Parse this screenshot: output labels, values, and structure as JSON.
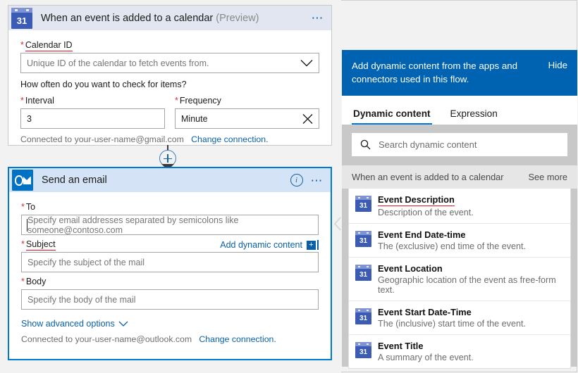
{
  "trigger_card": {
    "icon": "calendar-31-icon",
    "icon_text": "31",
    "title": "When an event is added to a calendar",
    "title_suffix": "(Preview)",
    "more_icon": "ellipsis-icon",
    "calendar_id_label": "Calendar ID",
    "calendar_id_placeholder": "Unique ID of the calendar to fetch events from.",
    "calendar_id_chevron": "chevron-down-icon",
    "check_question": "How often do you want to check for items?",
    "interval_label": "Interval",
    "interval_value": "3",
    "frequency_label": "Frequency",
    "frequency_value": "Minute",
    "frequency_clear_icon": "close-icon",
    "connected_text": "Connected to your-user-name@gmail.com",
    "change_connection": "Change connection.",
    "required_mark": "*"
  },
  "connector": {
    "add_step_icon": "plus-circle-icon",
    "arrow_icon": "arrow-down-icon"
  },
  "action_card": {
    "icon": "outlook-icon",
    "title": "Send an email",
    "info_icon": "info-icon",
    "more_icon": "ellipsis-icon",
    "to_label": "To",
    "to_placeholder": "Specify email addresses separated by semicolons like someone@contoso.com",
    "add_dynamic_content": "Add dynamic content",
    "add_dynamic_icon": "plus-square-icon",
    "subject_label": "Subject",
    "subject_placeholder": "Specify the subject of the mail",
    "body_label": "Body",
    "body_placeholder": "Specify the body of the mail",
    "show_advanced": "Show advanced options",
    "show_advanced_icon": "chevron-down-icon",
    "connected_text": "Connected to your-user-name@outlook.com",
    "change_connection": "Change connection.",
    "required_mark": "*"
  },
  "panel_handle_icon": "chevron-left-icon",
  "panel": {
    "header_text": "Add dynamic content from the apps and connectors used in this flow.",
    "hide_label": "Hide",
    "tabs": [
      {
        "label": "Dynamic content",
        "active": true
      },
      {
        "label": "Expression",
        "active": false
      }
    ],
    "search_icon": "search-icon",
    "search_placeholder": "Search dynamic content",
    "group_title": "When an event is added to a calendar",
    "see_more_label": "See more",
    "items": [
      {
        "icon": "calendar-31-icon",
        "icon_text": "31",
        "name": "Event Description",
        "desc": "Description of the event.",
        "highlighted": true
      },
      {
        "icon": "calendar-31-icon",
        "icon_text": "31",
        "name": "Event End Date-time",
        "desc": "The (exclusive) end time of the event.",
        "highlighted": false
      },
      {
        "icon": "calendar-31-icon",
        "icon_text": "31",
        "name": "Event Location",
        "desc": "Geographic location of the event as free-form text.",
        "highlighted": false
      },
      {
        "icon": "calendar-31-icon",
        "icon_text": "31",
        "name": "Event Start Date-Time",
        "desc": "The (inclusive) start time of the event.",
        "highlighted": false
      },
      {
        "icon": "calendar-31-icon",
        "icon_text": "31",
        "name": "Event Title",
        "desc": "A summary of the event.",
        "highlighted": false
      }
    ]
  },
  "colors": {
    "panel_header_blue": "#0063b1",
    "accent_blue": "#0078d4",
    "link_blue": "#0a60a8",
    "required_red": "#d13438",
    "highlight_red": "#e81123",
    "trigger_header": "#e1e6f0",
    "action_header": "#d4e4f6"
  }
}
